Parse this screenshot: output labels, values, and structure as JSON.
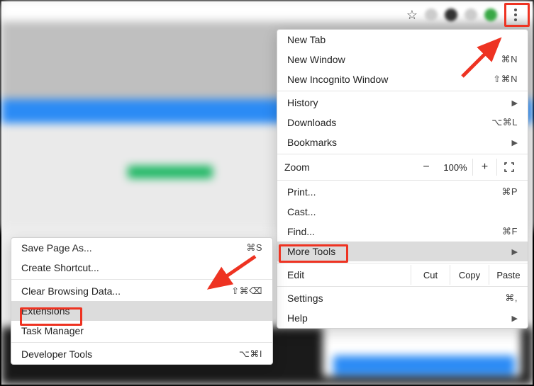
{
  "toolbar": {
    "star_glyph": "☆"
  },
  "main_menu": {
    "new_tab": "New Tab",
    "new_window": "New Window",
    "new_window_sc": "⌘N",
    "incognito": "New Incognito Window",
    "incognito_sc": "⇧⌘N",
    "history": "History",
    "downloads": "Downloads",
    "downloads_sc": "⌥⌘L",
    "bookmarks": "Bookmarks",
    "zoom_label": "Zoom",
    "zoom_minus": "−",
    "zoom_pct": "100%",
    "zoom_plus": "+",
    "print": "Print...",
    "print_sc": "⌘P",
    "cast": "Cast...",
    "find": "Find...",
    "find_sc": "⌘F",
    "more_tools": "More Tools",
    "edit": "Edit",
    "cut": "Cut",
    "copy": "Copy",
    "paste": "Paste",
    "settings": "Settings",
    "settings_sc": "⌘,",
    "help": "Help"
  },
  "sub_menu": {
    "save_page": "Save Page As...",
    "save_page_sc": "⌘S",
    "create_shortcut": "Create Shortcut...",
    "clear_data": "Clear Browsing Data...",
    "clear_data_sc": "⇧⌘⌫",
    "extensions": "Extensions",
    "task_manager": "Task Manager",
    "dev_tools": "Developer Tools",
    "dev_tools_sc": "⌥⌘I"
  }
}
